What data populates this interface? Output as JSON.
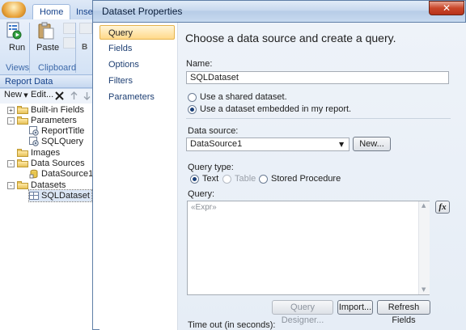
{
  "background_app": {
    "tabs": [
      "Home",
      "Inser"
    ],
    "ribbon": {
      "run_label": "Run",
      "paste_label": "Paste",
      "group_views": "Views",
      "group_clipboard": "Clipboard",
      "small_tool_letter": "B"
    },
    "report_data": {
      "header": "Report Data",
      "toolbar": {
        "new_label": "New",
        "edit_label": "Edit...",
        "delete_icon": "delete-x-icon",
        "up_icon": "move-up-icon",
        "down_icon": "move-down-icon"
      },
      "tree": [
        {
          "label": "Built-in Fields",
          "icon": "folder-icon",
          "expander": "+"
        },
        {
          "label": "Parameters",
          "icon": "folder-icon",
          "expander": "-"
        },
        {
          "label": "ReportTitle",
          "icon": "parameter-icon"
        },
        {
          "label": "SQLQuery",
          "icon": "parameter-icon"
        },
        {
          "label": "Images",
          "icon": "folder-icon"
        },
        {
          "label": "Data Sources",
          "icon": "folder-icon",
          "expander": "-"
        },
        {
          "label": "DataSource1",
          "icon": "datasource-icon"
        },
        {
          "label": "Datasets",
          "icon": "folder-icon",
          "expander": "-"
        },
        {
          "label": "SQLDataset",
          "icon": "dataset-icon",
          "selected": true
        }
      ]
    }
  },
  "dialog": {
    "title": "Dataset Properties",
    "close_glyph": "✕",
    "nav": [
      "Query",
      "Fields",
      "Options",
      "Filters",
      "Parameters"
    ],
    "heading": "Choose a data source and create a query.",
    "name_label": "Name:",
    "name_value": "SQLDataset",
    "dataset_options": {
      "shared": "Use a shared dataset.",
      "embedded": "Use a dataset embedded in my report.",
      "selected": "embedded"
    },
    "data_source_label": "Data source:",
    "data_source_value": "DataSource1",
    "dropdown_arrow": "▼",
    "new_button": "New...",
    "query_type_label": "Query type:",
    "query_types": {
      "text": "Text",
      "table": "Table",
      "stored_procedure": "Stored Procedure",
      "selected": "text"
    },
    "query_label": "Query:",
    "query_placeholder": "«Expr»",
    "fx_label": "fx",
    "scroll_up": "▲",
    "scroll_down": "▼",
    "buttons": {
      "query_designer": "Query Designer...",
      "import": "Import...",
      "refresh_fields": "Refresh Fields"
    },
    "timeout_label": "Time out (in seconds):"
  },
  "colors": {
    "accent_selected_nav": "#ffd98a",
    "titlebar": "#c8d9ee",
    "close_button": "#c9472a"
  }
}
